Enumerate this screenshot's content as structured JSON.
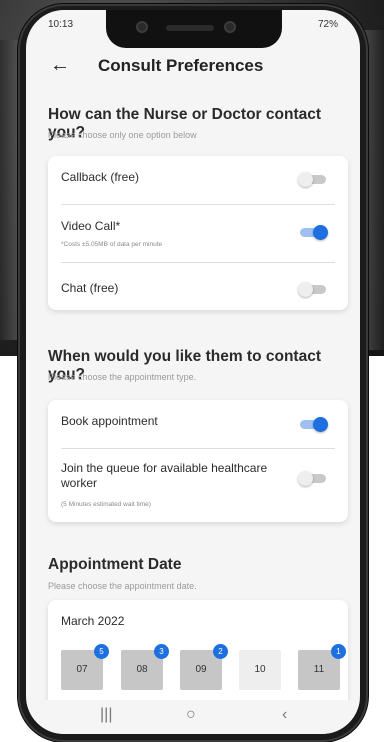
{
  "status": {
    "time": "10:13",
    "battery": "72%"
  },
  "header": {
    "back_icon": "back-arrow-icon",
    "title": "Consult Preferences"
  },
  "contact": {
    "title": "How can the Nurse or Doctor contact you?",
    "subtitle": "Please choose only one option below",
    "options": [
      {
        "label": "Callback (free)",
        "note": "",
        "enabled": false
      },
      {
        "label": "Video Call*",
        "note": "*Costs ±5.05MB of data per minute",
        "enabled": true
      },
      {
        "label": "Chat (free)",
        "note": "",
        "enabled": false
      }
    ]
  },
  "timing": {
    "title": "When would you like them to contact you?",
    "subtitle": "Please choose the appointment type.",
    "options": [
      {
        "label": "Book appointment",
        "note": "",
        "enabled": true
      },
      {
        "label": "Join the queue for available healthcare worker",
        "note": "(5 Minutes estimated wait time)",
        "enabled": false
      }
    ]
  },
  "appointment": {
    "title": "Appointment Date",
    "subtitle": "Please choose the appointment date.",
    "month": "March 2022",
    "days": [
      {
        "day": "07",
        "slots": "5"
      },
      {
        "day": "08",
        "slots": "3"
      },
      {
        "day": "09",
        "slots": "2"
      },
      {
        "day": "10",
        "slots": ""
      },
      {
        "day": "11",
        "slots": "1"
      }
    ]
  },
  "nav": {
    "recents": "|||",
    "home": "○",
    "back": "‹"
  },
  "colors": {
    "accent": "#1e6fe0",
    "toggle_on_track": "#9ec1f2",
    "day_bg": "#c6c6c6"
  }
}
